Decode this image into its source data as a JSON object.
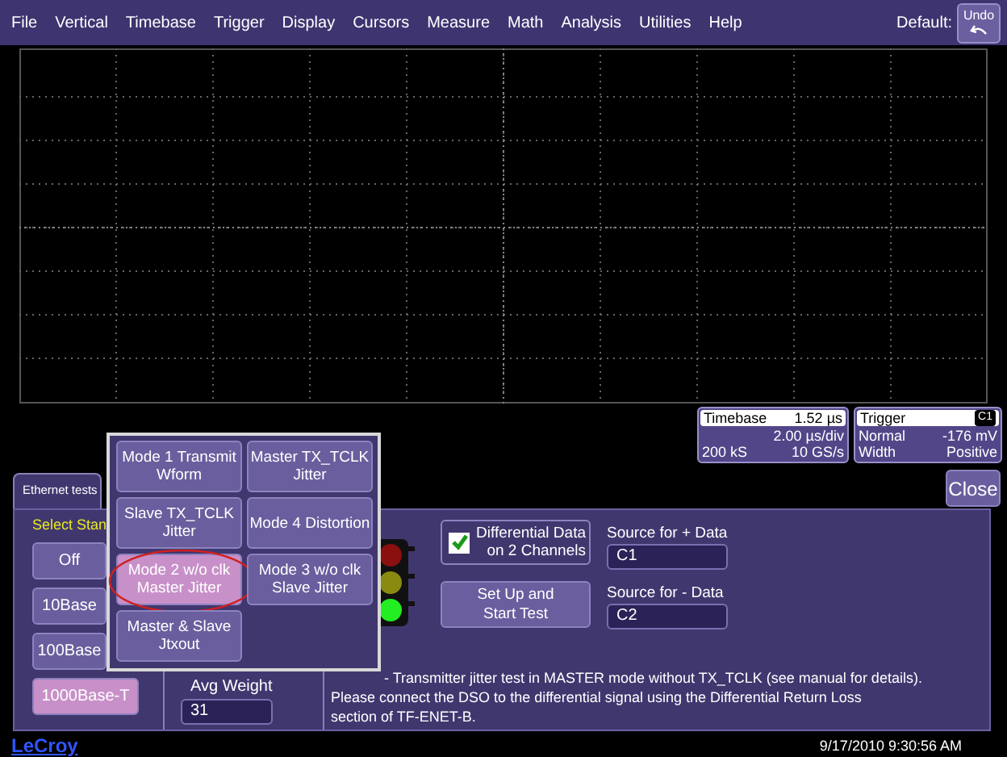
{
  "menu": {
    "items": [
      "File",
      "Vertical",
      "Timebase",
      "Trigger",
      "Display",
      "Cursors",
      "Measure",
      "Math",
      "Analysis",
      "Utilities",
      "Help"
    ],
    "default_label": "Default:",
    "undo": "Undo"
  },
  "timebase": {
    "title": "Timebase",
    "value": "1.52 µs",
    "per_div": "2.00 µs/div",
    "samples": "200 kS",
    "rate": "10 GS/s"
  },
  "trigger": {
    "title": "Trigger",
    "channel": "C1",
    "mode": "Normal",
    "level": "-176 mV",
    "type": "Width",
    "slope": "Positive"
  },
  "close_button": "Close",
  "panel": {
    "tab": "Ethernet tests",
    "select_label": "Select Stan",
    "standards": [
      {
        "label": "Off",
        "selected": false
      },
      {
        "label": "10Base",
        "selected": false
      },
      {
        "label": "100Base",
        "selected": false
      },
      {
        "label": "1000Base-T",
        "selected": true
      }
    ],
    "avg_weight": {
      "label": "Avg Weight",
      "value": "31"
    },
    "differential": {
      "label": "Differential Data on 2 Channels",
      "checked": true
    },
    "setup_button": "Set Up and Start Test",
    "sources": [
      {
        "label": "Source for + Data",
        "value": "C1"
      },
      {
        "label": "Source for - Data",
        "value": "C2"
      }
    ],
    "description": [
      "- Transmitter jitter test in MASTER mode without TX_TCLK (see manual for details).",
      "Please connect the DSO to the differential signal using the Differential Return Loss",
      "section of TF-ENET-B."
    ]
  },
  "test_menu": [
    {
      "label": "Mode 1 Transmit Wform",
      "selected": false,
      "circled": false
    },
    {
      "label": "Master TX_TCLK Jitter",
      "selected": false,
      "circled": false
    },
    {
      "label": "Slave TX_TCLK Jitter",
      "selected": false,
      "circled": false
    },
    {
      "label": "Mode 4 Distortion",
      "selected": false,
      "circled": false
    },
    {
      "label": "Mode 2 w/o clk Master Jitter",
      "selected": true,
      "circled": true
    },
    {
      "label": "Mode 3 w/o clk Slave Jitter",
      "selected": false,
      "circled": false
    },
    {
      "label": "Master & Slave Jtxout",
      "selected": false,
      "circled": false
    }
  ],
  "footer": {
    "logo_link": "LeCroy",
    "datetime": "9/17/2010 9:30:56 AM"
  }
}
